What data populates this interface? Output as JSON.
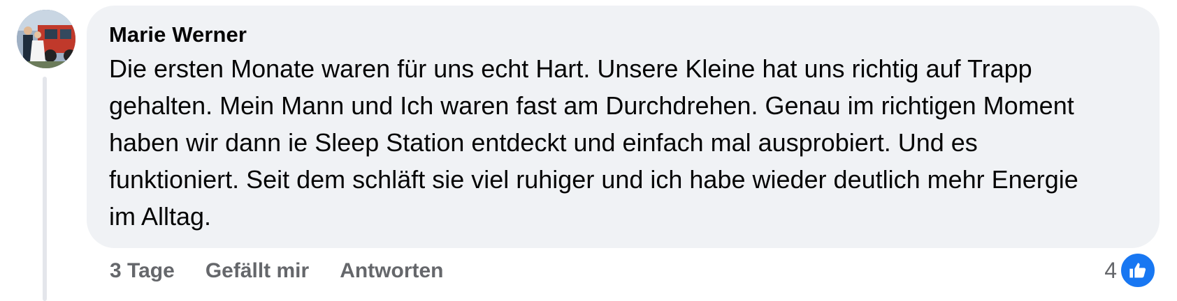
{
  "comment": {
    "author": "Marie Werner",
    "text": "Die ersten Monate waren für uns echt Hart. Unsere Kleine hat uns richtig auf Trapp gehalten. Mein Mann und Ich waren fast am Durchdrehen. Genau im richtigen Moment haben wir dann ie Sleep Station entdeckt und einfach mal ausprobiert. Und es funktioniert. Seit dem schläft sie viel ruhiger und ich habe wieder deutlich mehr Energie im Alltag."
  },
  "actions": {
    "timestamp": "3 Tage",
    "like_label": "Gefällt mir",
    "reply_label": "Antworten"
  },
  "reactions": {
    "count": "4",
    "icon": "thumbs-up-icon"
  },
  "colors": {
    "bubble_bg": "#f0f2f5",
    "text": "#050505",
    "secondary_text": "#65676b",
    "like_blue": "#1877f2"
  }
}
